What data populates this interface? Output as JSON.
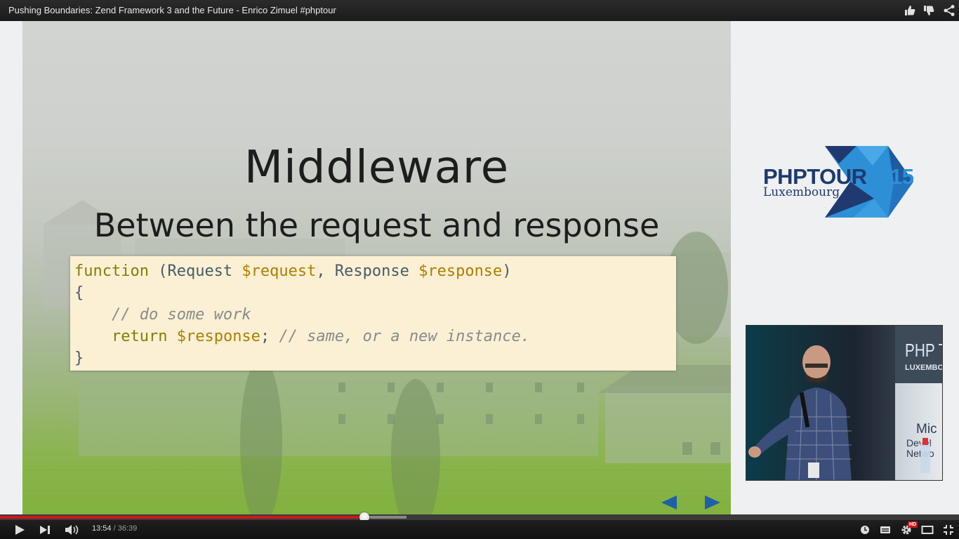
{
  "top_bar": {
    "title": "Pushing Boundaries: Zend Framework 3 and the Future - Enrico Zimuel #phptour",
    "icons": [
      "thumbs-up-icon",
      "thumbs-down-icon",
      "share-icon"
    ]
  },
  "slide": {
    "title": "Middleware",
    "subtitle": "Between the request and response",
    "code": {
      "line1": {
        "kw": "function",
        "p1": " (Request ",
        "v1": "$request",
        "p2": ", Response ",
        "v2": "$response",
        "p3": ")"
      },
      "line2": "{",
      "line3": "    // do some work",
      "line4": {
        "indent": "    ",
        "kw": "return",
        "sp": " ",
        "var": "$response",
        "semi": "; ",
        "cm": "// same, or a new instance."
      },
      "line5": "}"
    },
    "nav_icons": [
      "previous-slide-icon",
      "next-slide-icon"
    ]
  },
  "logo": {
    "part1": "PHPTOUR",
    "part2": "2015",
    "subtitle": "Luxembourg",
    "colors": {
      "dark": "#1e3a6e",
      "accent": "#2d8fd6"
    }
  },
  "speaker_inset": {
    "banner_text": "PHP T",
    "banner_sub": "LUXEMBOU",
    "sponsor_name": "Mic",
    "sponsor_sub": "Devel\nNetwo"
  },
  "player": {
    "progress_fraction": 0.38,
    "buffered_fraction": 0.424,
    "current_time": "13:54",
    "separator": " / ",
    "duration": "36:39",
    "hd_label": "HD",
    "accent_color": "#cc181e",
    "controls": [
      "play-icon",
      "next-icon",
      "volume-icon",
      "watch-later-icon",
      "captions-icon",
      "settings-icon",
      "theater-mode-icon",
      "fullscreen-icon"
    ]
  }
}
